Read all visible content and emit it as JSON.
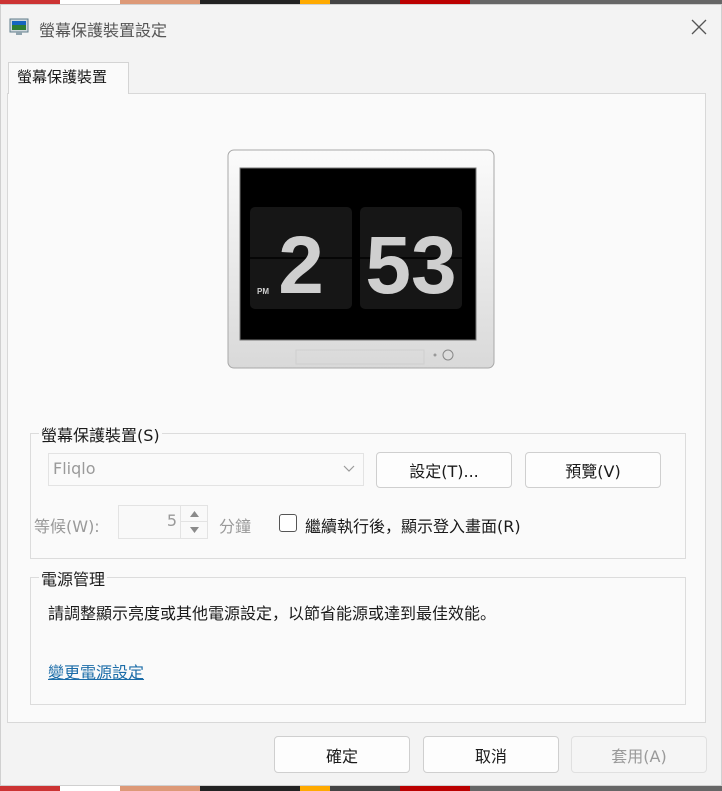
{
  "window": {
    "title": "螢幕保護裝置設定"
  },
  "tab": {
    "label": "螢幕保護裝置"
  },
  "preview": {
    "hour": "2",
    "minutes": "53",
    "ampm": "PM"
  },
  "screensaver": {
    "group_label": "螢幕保護裝置(S)",
    "selected": "Fliqlo",
    "settings_button": "設定(T)...",
    "preview_button": "預覽(V)",
    "wait_label": "等候(W):",
    "wait_value": "5",
    "minutes_label": "分鐘",
    "resume_label": "繼續執行後，顯示登入畫面(R)",
    "resume_checked": false
  },
  "power": {
    "group_label": "電源管理",
    "description": "請調整顯示亮度或其他電源設定，以節省能源或達到最佳效能。",
    "link": "變更電源設定"
  },
  "footer": {
    "ok": "確定",
    "cancel": "取消",
    "apply": "套用(A)"
  }
}
